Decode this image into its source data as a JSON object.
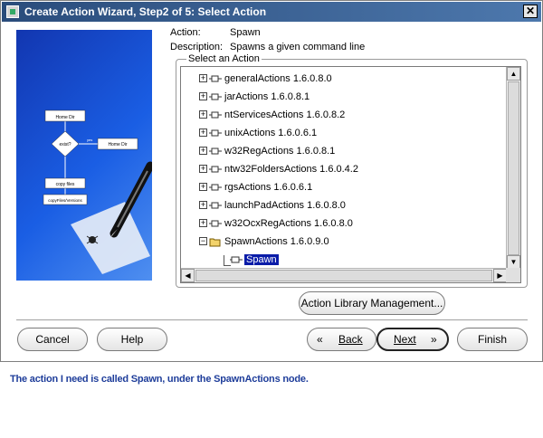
{
  "window": {
    "title": "Create Action Wizard, Step2 of 5: Select Action",
    "close_glyph": "✕"
  },
  "action": {
    "label": "Action:",
    "value": "Spawn",
    "description_label": "Description:",
    "description_value": "Spawns a given command line"
  },
  "tree": {
    "group_title": "Select an Action",
    "nodes": [
      {
        "label": "generalActions 1.6.0.8.0",
        "expander": "+"
      },
      {
        "label": "jarActions 1.6.0.8.1",
        "expander": "+"
      },
      {
        "label": "ntServicesActions 1.6.0.8.2",
        "expander": "+"
      },
      {
        "label": "unixActions 1.6.0.6.1",
        "expander": "+"
      },
      {
        "label": "w32RegActions 1.6.0.8.1",
        "expander": "+"
      },
      {
        "label": "ntw32FoldersActions 1.6.0.4.2",
        "expander": "+"
      },
      {
        "label": "rgsActions 1.6.0.6.1",
        "expander": "+"
      },
      {
        "label": "launchPadActions 1.6.0.8.0",
        "expander": "+"
      },
      {
        "label": "w32OcxRegActions 1.6.0.8.0",
        "expander": "+"
      },
      {
        "label": "SpawnActions 1.6.0.9.0",
        "expander": "−"
      }
    ],
    "child": {
      "label": "Spawn"
    }
  },
  "art": {
    "box1": "Home Dir",
    "decision": "exist?",
    "box2": "Home Dir",
    "yes": "yes",
    "box3": "copy files",
    "box4": "copyFiles/Versions"
  },
  "buttons": {
    "library": "Action Library Management...",
    "cancel": "Cancel",
    "help": "Help",
    "back": "Back",
    "next": "Next",
    "finish": "Finish"
  },
  "caption": "The action I need is called Spawn, under the SpawnActions node.",
  "colors": {
    "title_bar": "#2a4c7b",
    "selection": "#0a1ca8",
    "caption": "#1e3d9a"
  }
}
